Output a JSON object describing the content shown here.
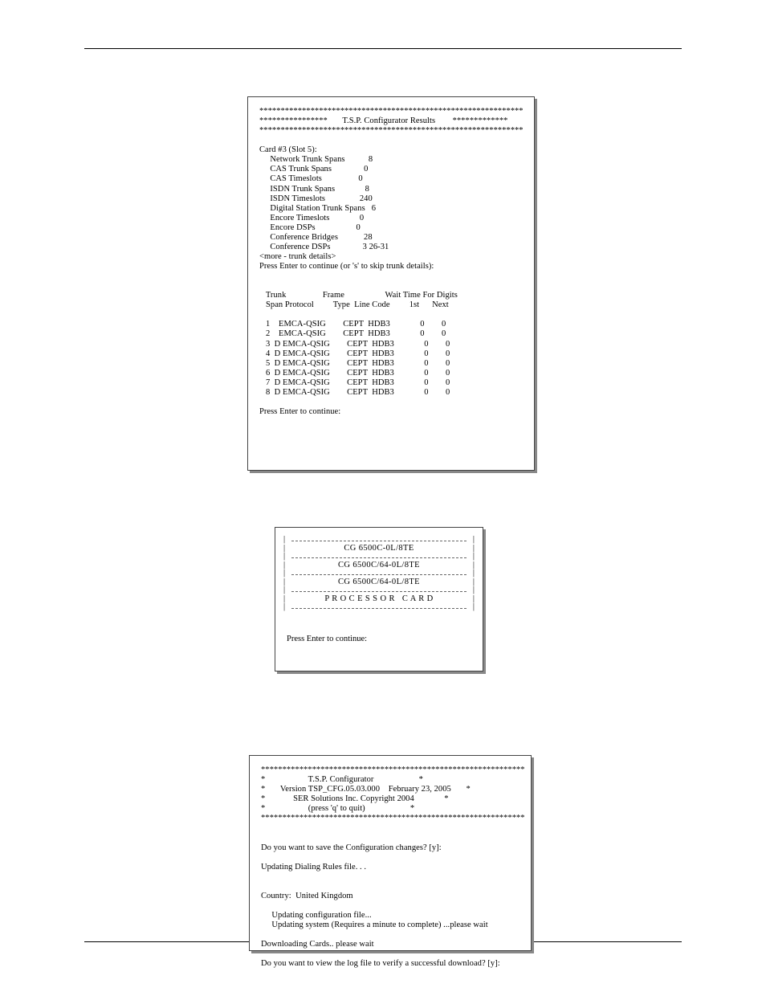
{
  "panel1": {
    "star_row": "**************************************************************",
    "title_row": "****************       T.S.P. Configurator Results        *************",
    "card_header": "Card #3 (Slot 5):",
    "stats": [
      {
        "label": "Network Trunk Spans",
        "value": "8"
      },
      {
        "label": "CAS Trunk Spans",
        "value": "0"
      },
      {
        "label": "CAS Timeslots",
        "value": "0"
      },
      {
        "label": "ISDN Trunk Spans",
        "value": "8"
      },
      {
        "label": "ISDN Timeslots",
        "value": "240"
      },
      {
        "label": "Digital Station Trunk Spans",
        "value": "6"
      },
      {
        "label": "Encore Timeslots",
        "value": "0"
      },
      {
        "label": "Encore DSPs",
        "value": "0"
      },
      {
        "label": "Conference Bridges",
        "value": "28"
      },
      {
        "label": "Conference DSPs",
        "value": "3 26-31"
      }
    ],
    "more_line": "<more - trunk details>",
    "prompt1": "Press Enter to continue (or 's' to skip trunk details):",
    "table": {
      "h1a": "Trunk",
      "h2a": "Frame",
      "h3a": "Wait Time For Digits",
      "h1b": "Span Protocol",
      "h2b": "Type  Line Code",
      "h3b": "1st",
      "h3c": "Next",
      "rows": [
        {
          "span": "1",
          "d": " ",
          "proto": "EMCA-QSIG",
          "type": "CEPT",
          "code": "HDB3",
          "first": "0",
          "next": "0"
        },
        {
          "span": "2",
          "d": " ",
          "proto": "EMCA-QSIG",
          "type": "CEPT",
          "code": "HDB3",
          "first": "0",
          "next": "0"
        },
        {
          "span": "3",
          "d": "D",
          "proto": "EMCA-QSIG",
          "type": "CEPT",
          "code": "HDB3",
          "first": "0",
          "next": "0"
        },
        {
          "span": "4",
          "d": "D",
          "proto": "EMCA-QSIG",
          "type": "CEPT",
          "code": "HDB3",
          "first": "0",
          "next": "0"
        },
        {
          "span": "5",
          "d": "D",
          "proto": "EMCA-QSIG",
          "type": "CEPT",
          "code": "HDB3",
          "first": "0",
          "next": "0"
        },
        {
          "span": "6",
          "d": "D",
          "proto": "EMCA-QSIG",
          "type": "CEPT",
          "code": "HDB3",
          "first": "0",
          "next": "0"
        },
        {
          "span": "7",
          "d": "D",
          "proto": "EMCA-QSIG",
          "type": "CEPT",
          "code": "HDB3",
          "first": "0",
          "next": "0"
        },
        {
          "span": "8",
          "d": "D",
          "proto": "EMCA-QSIG",
          "type": "CEPT",
          "code": "HDB3",
          "first": "0",
          "next": "0"
        }
      ]
    },
    "prompt2": "Press Enter to continue:"
  },
  "panel2": {
    "cards": [
      "CG 6500C-0L/8TE",
      "CG 6500C/64-0L/8TE",
      "CG 6500C/64-0L/8TE",
      "P R O C E S S O R   C A R D"
    ],
    "prompt": "Press Enter to continue:"
  },
  "panel3": {
    "star_row": "**************************************************************",
    "boxed": [
      "T.S.P. Configurator",
      "Version TSP_CFG.05.03.000    February 23, 2005",
      "SER Solutions Inc. Copyright 2004",
      "(press 'q' to quit)"
    ],
    "lines": [
      "Do you want to save the Configuration changes? [y]:",
      "",
      "Updating Dialing Rules file. . .",
      "",
      "",
      "Country:  United Kingdom",
      "",
      "     Updating configuration file...",
      "     Updating system (Requires a minute to complete) ...please wait",
      "",
      "Downloading Cards.. please wait",
      "",
      "Do you want to view the log file to verify a successful download? [y]:"
    ]
  }
}
